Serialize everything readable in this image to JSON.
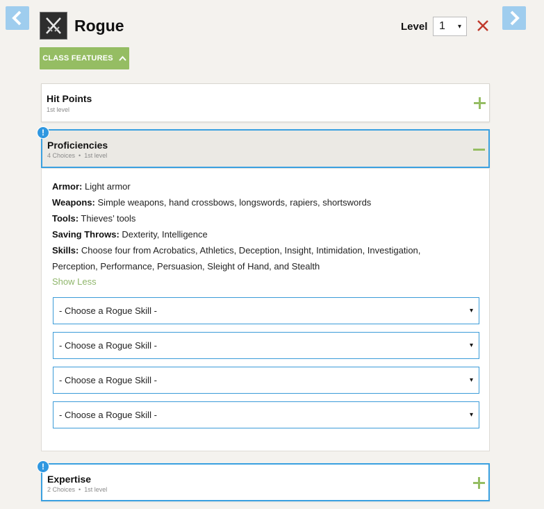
{
  "header": {
    "class_name": "Rogue",
    "level_label": "Level",
    "level_value": "1",
    "features_button": "CLASS FEATURES"
  },
  "panels": {
    "hit_points": {
      "title": "Hit Points",
      "level": "1st level"
    },
    "proficiencies": {
      "title": "Proficiencies",
      "choices": "4 Choices",
      "level": "1st level"
    },
    "expertise": {
      "title": "Expertise",
      "choices": "2 Choices",
      "level": "1st level"
    }
  },
  "proficiencies": {
    "armor_label": "Armor:",
    "armor": "Light armor",
    "weapons_label": "Weapons:",
    "weapons": "Simple weapons, hand crossbows, longswords, rapiers, shortswords",
    "tools_label": "Tools:",
    "tools": "Thieves’ tools",
    "saving_label": "Saving Throws:",
    "saving": "Dexterity, Intelligence",
    "skills_label": "Skills:",
    "skills_line1": "Choose four from Acrobatics, Athletics, Deception, Insight, Intimidation, Investigation,",
    "skills_line2": "Perception, Performance, Persuasion, Sleight of Hand, and Stealth",
    "show_less": "Show Less"
  },
  "skill_selects": [
    "- Choose a Rogue Skill -",
    "- Choose a Rogue Skill -",
    "- Choose a Rogue Skill -",
    "- Choose a Rogue Skill -"
  ],
  "badge_symbol": "!",
  "dropdown_caret": "▾",
  "colors": {
    "accent_green": "#95bd63",
    "nav_blue": "#9fcdee",
    "alert_blue": "#2f97e0",
    "close_red": "#c0392b"
  }
}
